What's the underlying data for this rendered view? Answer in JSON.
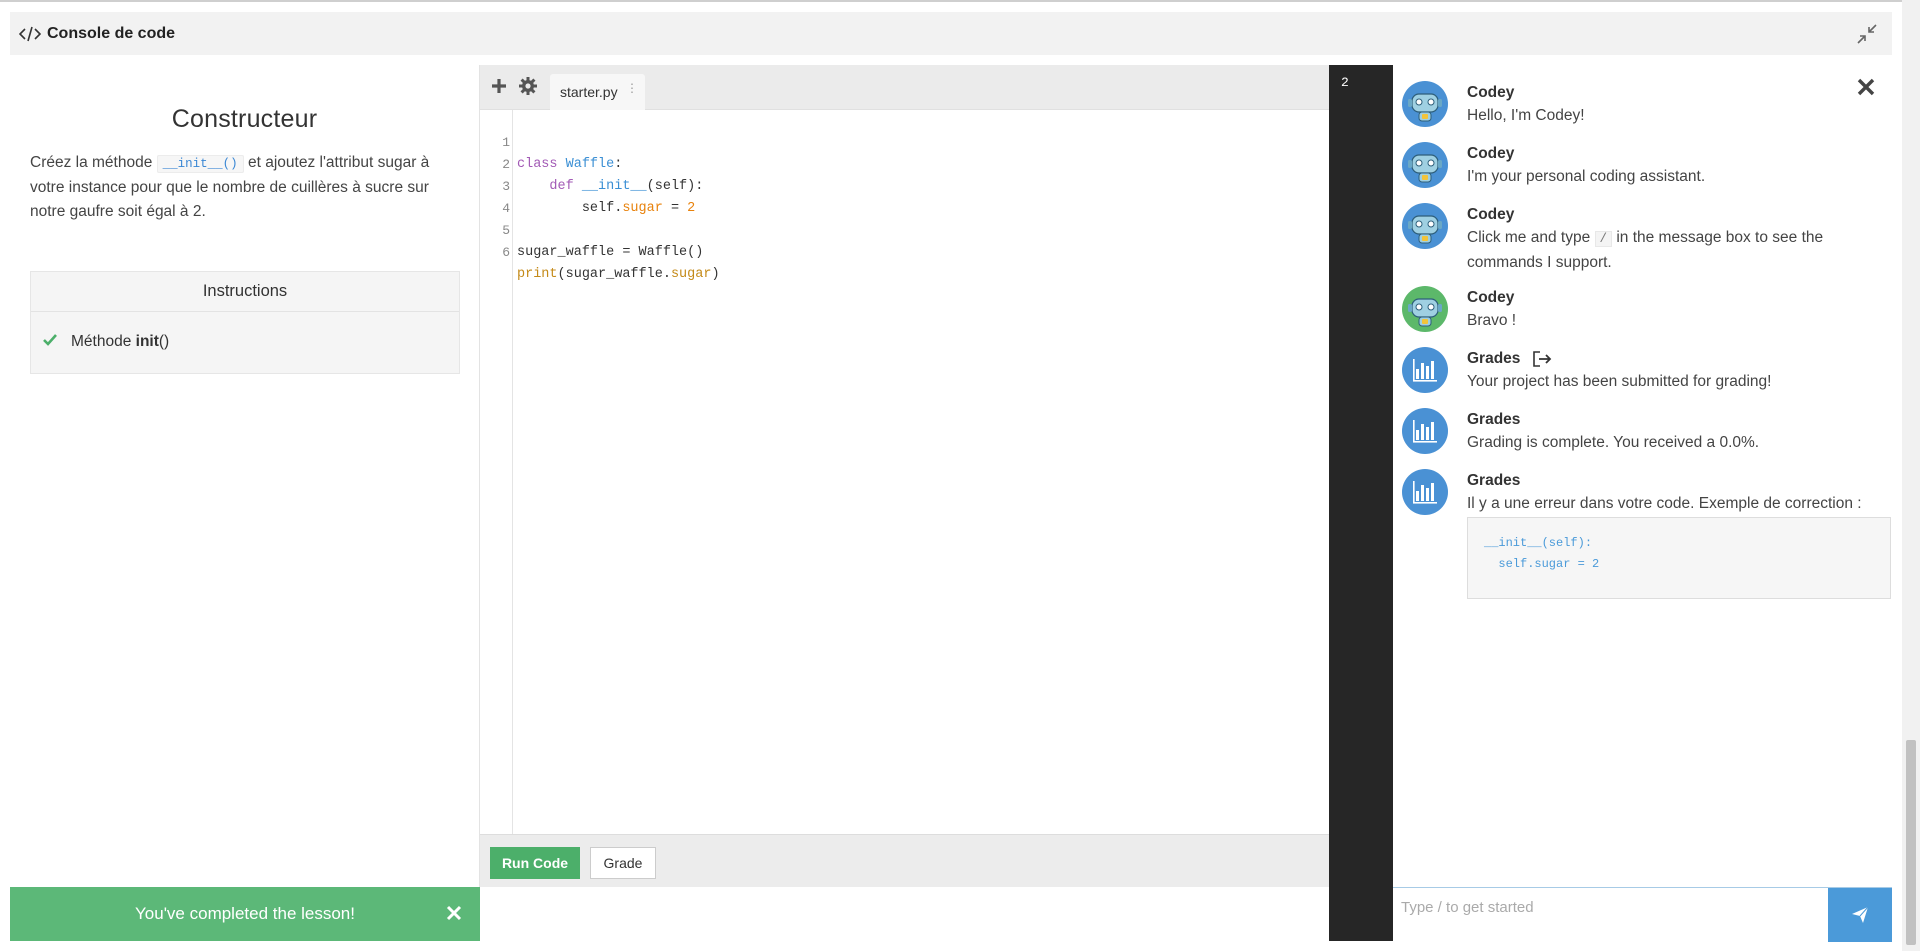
{
  "header": {
    "title": "Console de code"
  },
  "lesson": {
    "title": "Constructeur",
    "desc_part1": "Créez la méthode ",
    "desc_code": "__init__()",
    "desc_part2": " et ajoutez l'attribut sugar à votre instance pour que le nombre de cuillères à sucre sur notre gaufre soit égal à 2.",
    "instructions_title": "Instructions",
    "task_prefix": "Méthode ",
    "task_bold": "init",
    "task_suffix": "()"
  },
  "editor": {
    "tab_label": "starter.py",
    "lines": [
      "1",
      "2",
      "3",
      "4",
      "5",
      "6"
    ],
    "code": {
      "l1_kw": "class",
      "l1_cls": "Waffle",
      "l1_end": ":",
      "l2_kw": "def",
      "l2_fn": "__init__",
      "l2_end": "(self):",
      "l3_a": "self.",
      "l3_attr": "sugar",
      "l3_b": " = ",
      "l3_num": "2",
      "l5": "sugar_waffle = Waffle()",
      "l6_builtin": "print",
      "l6_a": "(sugar_waffle.",
      "l6_attr": "sugar",
      "l6_b": ")"
    },
    "run_label": "Run Code",
    "grade_label": "Grade"
  },
  "output": {
    "text": "2"
  },
  "chat": {
    "messages": [
      {
        "sender": "Codey",
        "text": "Hello, I'm Codey!"
      },
      {
        "sender": "Codey",
        "text": "I'm your personal coding assistant."
      },
      {
        "sender": "Codey",
        "text_a": "Click me and type ",
        "text_code": "/",
        "text_b": " in the message box to see the commands I support."
      },
      {
        "sender": "Codey",
        "text": "Bravo !"
      },
      {
        "sender": "Grades",
        "text": "Your project has been submitted for grading!"
      },
      {
        "sender": "Grades",
        "text": "Grading is complete. You received a 0.0%."
      },
      {
        "sender": "Grades",
        "text": "Il y a une erreur dans votre code. Exemple de correction :",
        "code_line1": "__init__(self):",
        "code_line2": "  self.sugar = 2"
      }
    ],
    "input_placeholder": "Type / to get started"
  },
  "banner": {
    "text": "You've completed the lesson!"
  },
  "colors": {
    "accent_green": "#5cb878",
    "accent_blue": "#4b9ad9",
    "console_bg": "#262626"
  },
  "icons": [
    "code-icon",
    "collapse-icon",
    "plus-icon",
    "gear-icon",
    "check-icon",
    "close-icon",
    "codey-robot-icon",
    "grades-chart-icon",
    "logout-icon",
    "send-icon"
  ]
}
